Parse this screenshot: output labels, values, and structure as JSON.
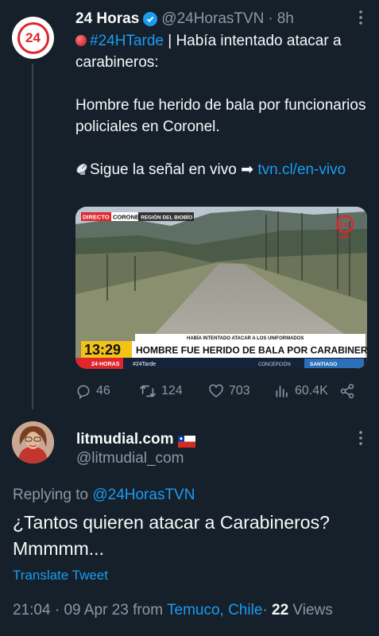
{
  "tweet": {
    "author_name": "24 Horas",
    "author_handle": "@24HorasTVN",
    "separator": "·",
    "time_ago": "8h",
    "avatar_text": "24",
    "hashtag": "#24HTarde",
    "line1_rest": " | Había intentado atacar a carabineros:",
    "line2": "Hombre fue herido de bala por funcionarios policiales en Coronel.",
    "line3_text": "Sigue la señal en vivo ➡ ",
    "line3_link": "tvn.cl/en-vivo",
    "media": {
      "badge_directo": "DIRECTO",
      "badge_location": "CORONEL",
      "badge_region": "REGIÓN DEL BIOBÍO",
      "kicker": "HABÍA INTENTADO ATACAR A LOS UNIFORMADOS",
      "clock": "13:29",
      "headline": "HOMBRE FUE HERIDO DE BALA POR CARABINEROS",
      "ticker_brand": "24·HORAS",
      "ticker_tag": "#24Tarde",
      "ticker_city": "SANTIAGO",
      "ticker_place": "CONCEPCIÓN",
      "logo_text": "24",
      "logo_sub": "VIVO"
    },
    "stats": {
      "replies": "46",
      "retweets": "124",
      "likes": "703",
      "views": "60.4K"
    }
  },
  "reply": {
    "author_name": "litmudial.com",
    "author_handle": "@litmudial_com",
    "replying_label": "Replying to ",
    "replying_handle": "@24HorasTVN",
    "text": "¿Tantos quieren atacar a Carabineros? Mmmmm...",
    "translate": "Translate Tweet",
    "time": "21:04",
    "dot": "·",
    "date": "09 Apr 23",
    "from": "from",
    "location": "Temuco, Chile",
    "views_count": "22",
    "views_label": "Views"
  },
  "colors": {
    "background": "#15202b",
    "accent": "#1d9bf0",
    "muted": "#8b98a5",
    "brand_red": "#e0262b"
  },
  "icons": [
    "verified-badge-icon",
    "more-icon",
    "red-circle-emoji-icon",
    "satellite-dish-icon",
    "reply-icon",
    "retweet-icon",
    "like-icon",
    "views-icon",
    "share-icon",
    "chile-flag-icon"
  ]
}
